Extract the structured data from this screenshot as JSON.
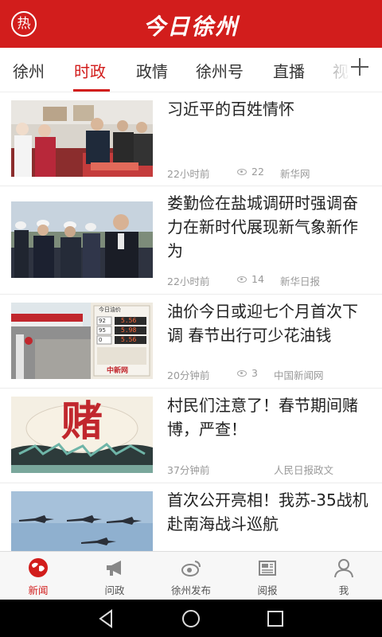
{
  "header": {
    "badge_label": "热",
    "title": "今日徐州"
  },
  "tabs": [
    {
      "label": "徐州",
      "active": false
    },
    {
      "label": "时政",
      "active": true
    },
    {
      "label": "政情",
      "active": false
    },
    {
      "label": "徐州号",
      "active": false
    },
    {
      "label": "直播",
      "active": false
    },
    {
      "label": "视",
      "active": false
    }
  ],
  "tab_more_icon": "plus-icon",
  "articles": [
    {
      "title": "习近平的百姓情怀",
      "time": "22小时前",
      "views": "22",
      "source": "新华网",
      "thumb_icon": "photo-people-shop"
    },
    {
      "title": "娄勤俭在盐城调研时强调奋力在新时代展现新气象新作为",
      "time": "22小时前",
      "views": "14",
      "source": "新华日报",
      "thumb_icon": "photo-officials-hardhats"
    },
    {
      "title": "油价今日或迎七个月首次下调 春节出行可少花油钱",
      "time": "20分钟前",
      "views": "3",
      "source": "中国新闻网",
      "thumb_icon": "photo-gas-station",
      "thumb_text": {
        "board_title": "今日油价",
        "prices": [
          "5.56",
          "5.98",
          "5.56"
        ],
        "board_labels": [
          "92",
          "95",
          "0"
        ],
        "caption": "中新网"
      }
    },
    {
      "title": "村民们注意了！春节期间赌博，严查！",
      "time": "37分钟前",
      "views": "",
      "source": "人民日报政文",
      "thumb_icon": "illustration-gambling",
      "thumb_text": {
        "big_char": "赌"
      }
    },
    {
      "title": "首次公开亮相！我苏-35战机赴南海战斗巡航",
      "time": "",
      "views": "",
      "source": "",
      "thumb_icon": "photo-fighter-jets"
    }
  ],
  "bottom_nav": [
    {
      "label": "新闻",
      "icon": "globe-icon",
      "active": true
    },
    {
      "label": "问政",
      "icon": "megaphone-icon",
      "active": false
    },
    {
      "label": "徐州发布",
      "icon": "weibo-icon",
      "active": false
    },
    {
      "label": "阅报",
      "icon": "newspaper-icon",
      "active": false
    },
    {
      "label": "我",
      "icon": "user-icon",
      "active": false
    }
  ],
  "system_bar": [
    "back-icon",
    "home-icon",
    "recents-icon"
  ],
  "colors": {
    "brand_red": "#d21d1c",
    "text": "#222222",
    "meta": "#999999"
  }
}
